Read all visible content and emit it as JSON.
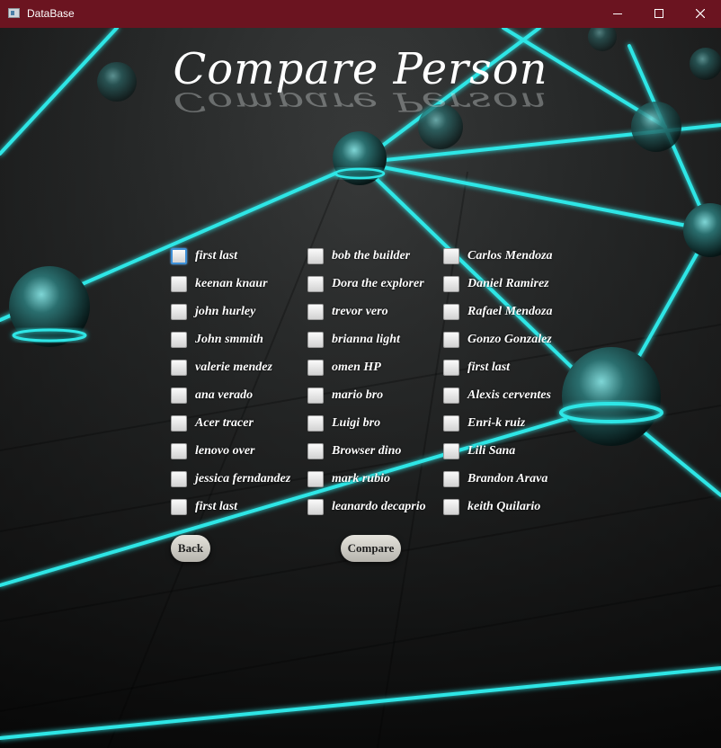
{
  "window": {
    "title": "DataBase"
  },
  "heading": "Compare Person",
  "columns": [
    {
      "items": [
        "first last",
        "keenan knaur",
        "john hurley",
        "John smmith",
        "valerie mendez",
        "ana verado",
        "Acer tracer",
        "lenovo over",
        "jessica ferndandez",
        "first last"
      ]
    },
    {
      "items": [
        "bob the builder",
        "Dora the explorer",
        "trevor vero",
        "brianna light",
        "omen HP",
        "mario bro",
        "Luigi bro",
        "Browser dino",
        "mark rubio",
        "leanardo decaprio"
      ]
    },
    {
      "items": [
        "Carlos Mendoza",
        "Daniel Ramirez",
        "Rafael Mendoza",
        "Gonzo Gonzalez",
        "first last",
        "Alexis cerventes",
        "Enri-k ruiz",
        "Lili Sana",
        "Brandon Arava",
        "keith Quilario"
      ]
    }
  ],
  "buttons": {
    "back": "Back",
    "compare": "Compare"
  },
  "colors": {
    "titlebar": "#6b1420",
    "accent_glow": "#2ee6e6"
  }
}
